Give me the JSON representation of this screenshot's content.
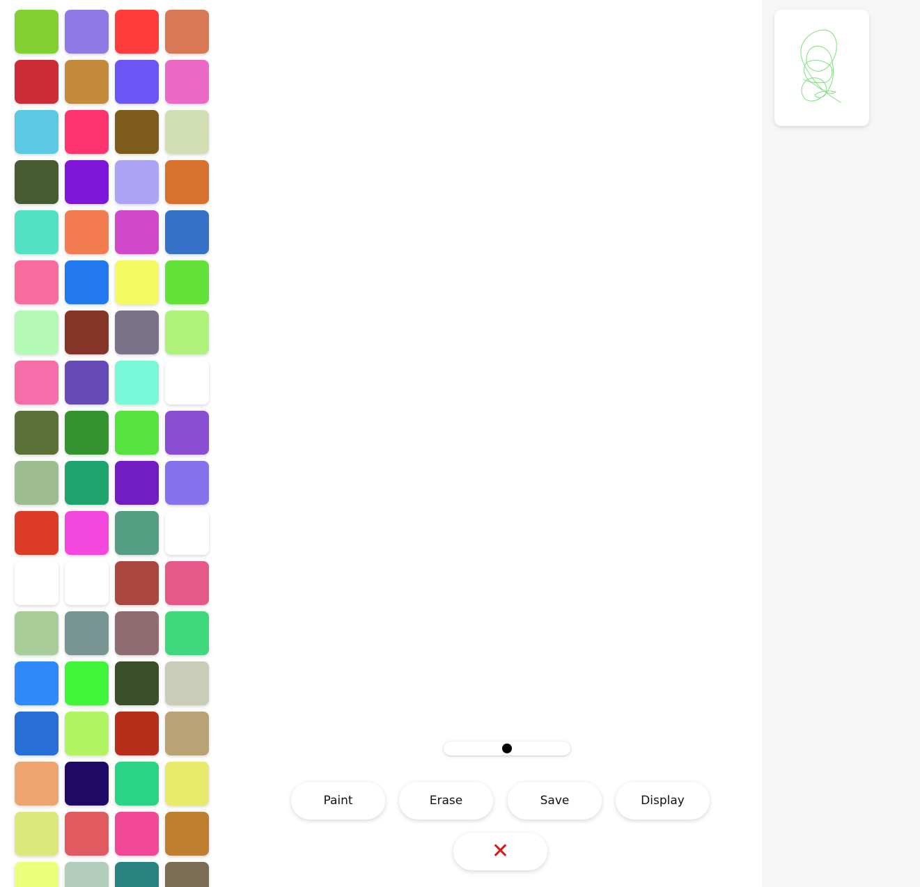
{
  "palette": {
    "colors": [
      "#82d032",
      "#8f7ae5",
      "#fe3c3c",
      "#d87855",
      "#cb2c35",
      "#c48a3c",
      "#6b55f5",
      "#ec69c7",
      "#5bc9e4",
      "#fd3470",
      "#7d5b1a",
      "#d2dfb4",
      "#465b31",
      "#7f17d8",
      "#aea4f7",
      "#d6712e",
      "#52e1c2",
      "#f37d50",
      "#d248cb",
      "#3672c7",
      "#f86c9e",
      "#2278ee",
      "#f5f962",
      "#64e23a",
      "#b4fab4",
      "#853427",
      "#7a7288",
      "#aef27b",
      "#f56ea9",
      "#664ab6",
      "#78f8d7",
      "#ffffff",
      "#5b7137",
      "#33942f",
      "#56e33f",
      "#8a4ed3",
      "#9dbd91",
      "#1fa46f",
      "#721dc3",
      "#8772ee",
      "#dd3c26",
      "#f447de",
      "#549f83",
      "#ffffff",
      "#ffffff",
      "#ffffff",
      "#ab4741",
      "#e45987",
      "#a9cd99",
      "#779593",
      "#8f6d73",
      "#40d87c",
      "#3089fa",
      "#40f53a",
      "#384f29",
      "#c9cdb8",
      "#276fd6",
      "#b1f462",
      "#b72f1a",
      "#b9a375",
      "#eda46e",
      "#1f0a65",
      "#2bd484",
      "#e8ea6c",
      "#dbe87c",
      "#e05a60",
      "#f24898",
      "#c07f30",
      "#eaff7a",
      "#b3cdbd",
      "#288380",
      "#7c6c53"
    ]
  },
  "brush": {
    "size_fraction": 0.5
  },
  "toolbar": {
    "paint_label": "Paint",
    "erase_label": "Erase",
    "save_label": "Save",
    "display_label": "Display",
    "close_label": "✕"
  },
  "gallery": {
    "thumbnail_stroke_color": "#7ee07e"
  }
}
